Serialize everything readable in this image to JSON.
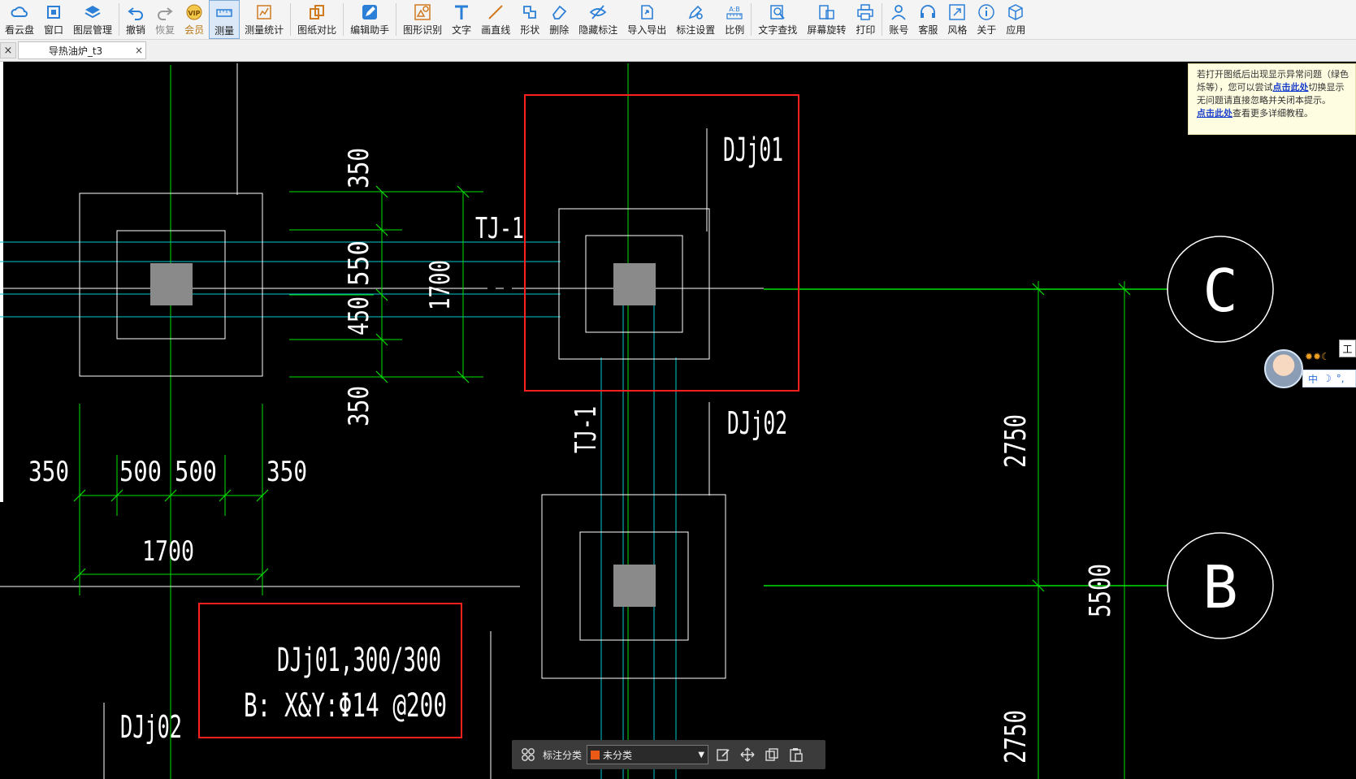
{
  "toolbar": {
    "items": [
      {
        "label": "看云盘",
        "icon": "cloud-icon"
      },
      {
        "label": "窗口",
        "icon": "window-icon"
      },
      {
        "label": "图层管理",
        "icon": "layers-icon"
      },
      {
        "label": "撤销",
        "icon": "undo-icon"
      },
      {
        "label": "恢复",
        "icon": "redo-icon"
      },
      {
        "label": "会员",
        "icon": "vip-icon"
      },
      {
        "label": "测量",
        "icon": "measure-icon"
      },
      {
        "label": "测量统计",
        "icon": "measure-stats-icon"
      },
      {
        "label": "图纸对比",
        "icon": "compare-icon"
      },
      {
        "label": "编辑助手",
        "icon": "edit-assistant-icon"
      },
      {
        "label": "图形识别",
        "icon": "shape-recognition-icon"
      },
      {
        "label": "文字",
        "icon": "text-icon"
      },
      {
        "label": "画直线",
        "icon": "line-icon"
      },
      {
        "label": "形状",
        "icon": "shape-icon"
      },
      {
        "label": "删除",
        "icon": "eraser-icon"
      },
      {
        "label": "隐藏标注",
        "icon": "hide-annotation-icon"
      },
      {
        "label": "导入导出",
        "icon": "import-export-icon"
      },
      {
        "label": "标注设置",
        "icon": "annotation-settings-icon"
      },
      {
        "label": "比例",
        "icon": "scale-icon"
      },
      {
        "label": "文字查找",
        "icon": "text-search-icon"
      },
      {
        "label": "屏幕旋转",
        "icon": "rotate-screen-icon"
      },
      {
        "label": "打印",
        "icon": "print-icon"
      },
      {
        "label": "账号",
        "icon": "account-icon"
      },
      {
        "label": "客服",
        "icon": "headset-icon"
      },
      {
        "label": "风格",
        "icon": "style-icon"
      },
      {
        "label": "关于",
        "icon": "info-icon"
      },
      {
        "label": "应用",
        "icon": "apps-icon"
      }
    ]
  },
  "tabs": {
    "close_left": "×",
    "doc_title": "导热油炉_t3",
    "doc_close": "×"
  },
  "notice": {
    "line1": "若打开图纸后出现显示异常问题（绿色",
    "line2a": "烁等），您可以尝试",
    "link1": "点击此处",
    "line2b": "切换显示",
    "line3": "无问题请直接忽略并关闭本提示。",
    "link2": "点击此处",
    "line4b": "查看更多详细教程。"
  },
  "ime": {
    "top": "✹✹☾",
    "lang": "中",
    "moon": "☽",
    "dots": "°,",
    "tag": "工"
  },
  "bottom_bar": {
    "label": "标注分类",
    "selected": "未分类",
    "selected_color": "#ea5a16"
  },
  "drawing": {
    "labels": {
      "dj01_top": "DJj01",
      "tj1_horizontal": "TJ-1",
      "tj1_vertical": "TJ-1",
      "dj02_right": "DJj02",
      "dj02_bottom": "DJj02",
      "annotation_line1": "DJj01,300/300",
      "annotation_line2": "B: X&Y:Φ14 @200",
      "axis_c": "C",
      "axis_b": "B"
    },
    "dims": {
      "v350_top": "350",
      "v550": "550",
      "v450": "450",
      "v350_bottom": "350",
      "v1700": "1700",
      "h350_left": "350",
      "h500_a": "500",
      "h500_b": "500",
      "h350_right": "350",
      "h1700": "1700",
      "v2750_top": "2750",
      "v5500": "5500",
      "v2750_bottom": "2750"
    },
    "colors": {
      "white": "#ffffff",
      "green": "#00e000",
      "cyan": "#00c8d0",
      "red": "#ff2020",
      "gray": "#8a8a8a"
    }
  }
}
